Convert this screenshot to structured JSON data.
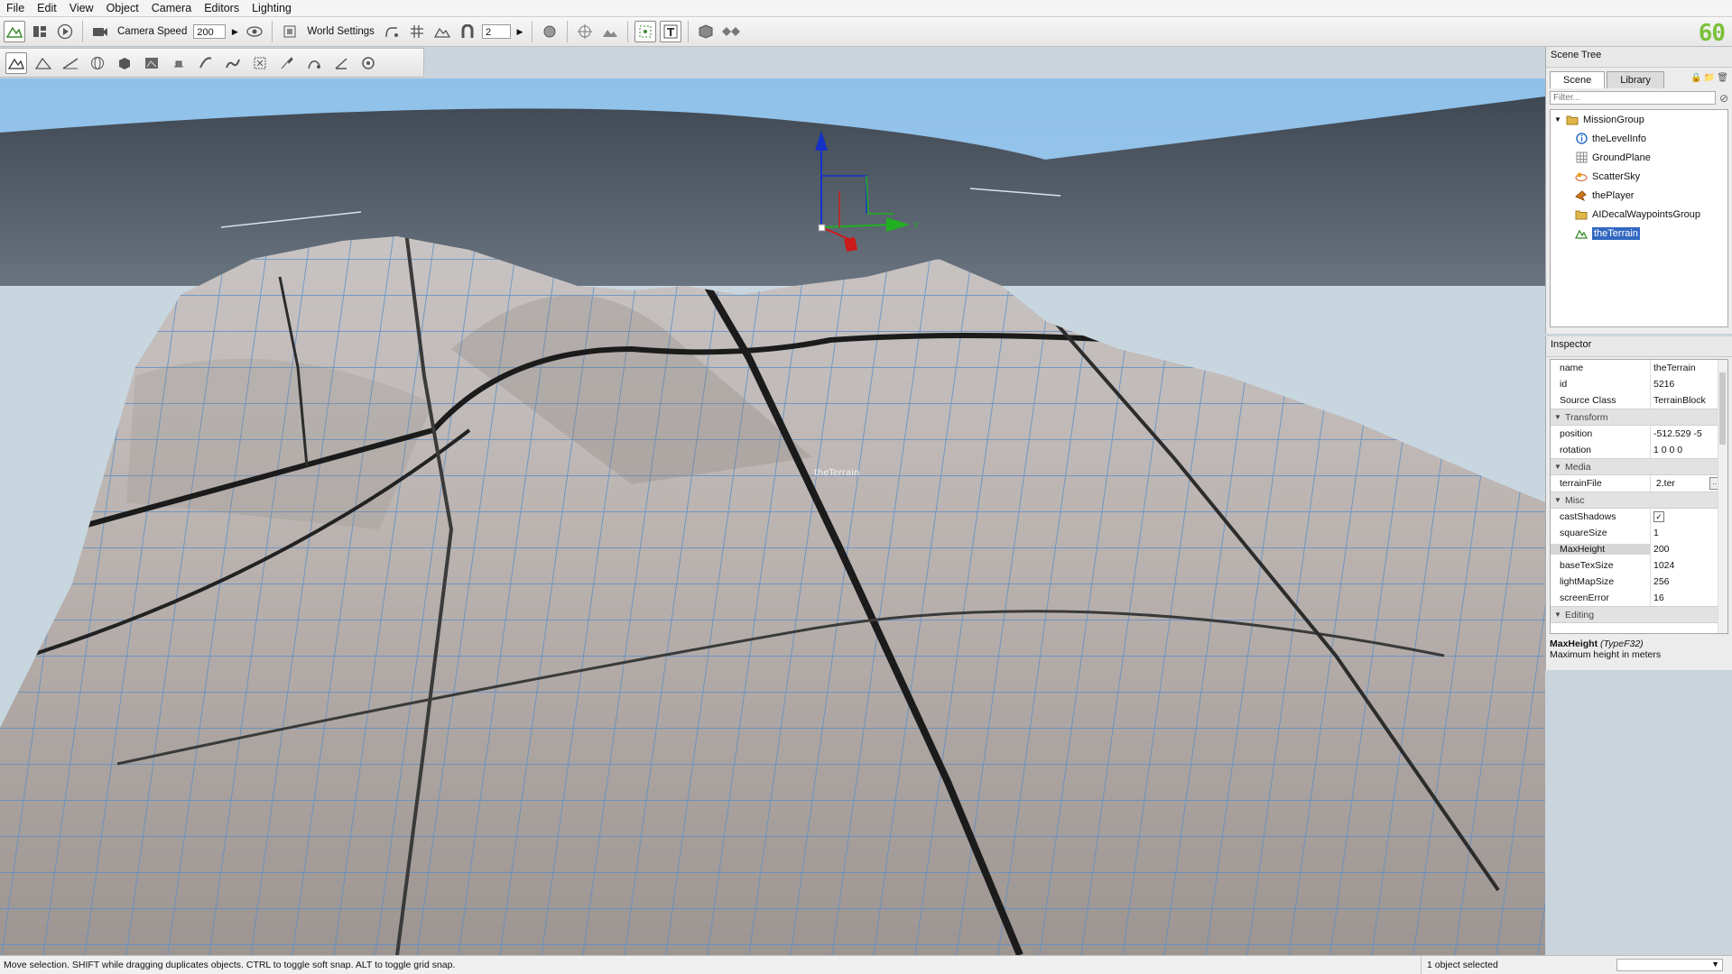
{
  "menu": [
    "File",
    "Edit",
    "View",
    "Object",
    "Camera",
    "Editors",
    "Lighting"
  ],
  "toolbar": {
    "camera_speed_label": "Camera Speed",
    "camera_speed_value": "200",
    "world_settings_label": "World Settings",
    "snap_value": "2",
    "fps": "60"
  },
  "viewport": {
    "object_label": "theTerrain",
    "gizmo_axis_y": "Y"
  },
  "scene_tree": {
    "title": "Scene Tree",
    "tabs": [
      "Scene",
      "Library"
    ],
    "filter_placeholder": "Filter...",
    "items": [
      {
        "label": "MissionGroup",
        "icon": "folder-icon",
        "depth": 0
      },
      {
        "label": "theLevelInfo",
        "icon": "info-icon",
        "depth": 1
      },
      {
        "label": "GroundPlane",
        "icon": "grid-plane-icon",
        "depth": 1
      },
      {
        "label": "ScatterSky",
        "icon": "sky-icon",
        "depth": 1
      },
      {
        "label": "thePlayer",
        "icon": "player-icon",
        "depth": 1
      },
      {
        "label": "AIDecalWaypointsGroup",
        "icon": "folder-icon",
        "depth": 1
      },
      {
        "label": "theTerrain",
        "icon": "terrain-icon",
        "depth": 1,
        "selected": true
      }
    ]
  },
  "inspector": {
    "title": "Inspector",
    "header_rows": [
      {
        "key": "name",
        "value": "theTerrain"
      },
      {
        "key": "id",
        "value": "5216"
      },
      {
        "key": "Source Class",
        "value": "TerrainBlock"
      }
    ],
    "transform_label": "Transform",
    "transform_rows": [
      {
        "key": "position",
        "value": "-512.529 -5"
      },
      {
        "key": "rotation",
        "value": "1 0 0 0"
      }
    ],
    "media_label": "Media",
    "media_rows": [
      {
        "key": "terrainFile",
        "value": " 2.ter"
      }
    ],
    "misc_label": "Misc",
    "misc_rows": [
      {
        "key": "castShadows",
        "value": "✓"
      },
      {
        "key": "squareSize",
        "value": "1"
      },
      {
        "key": "MaxHeight",
        "value": "200"
      },
      {
        "key": "baseTexSize",
        "value": "1024"
      },
      {
        "key": "lightMapSize",
        "value": "256"
      },
      {
        "key": "screenError",
        "value": "16"
      }
    ],
    "editing_label": "Editing",
    "desc_field": "MaxHeight",
    "desc_type": "(TypeF32)",
    "desc_text": "Maximum height in meters"
  },
  "status": {
    "hint": "Move selection.  SHIFT while dragging duplicates objects.  CTRL to toggle soft snap.  ALT to toggle grid snap.",
    "selection": "1 object selected"
  },
  "colors": {
    "fps_green": "#7cc13a",
    "selection_blue": "#3268c2",
    "sky_top": "#8fc1ea",
    "sky_horizon": "#c9d6df"
  }
}
